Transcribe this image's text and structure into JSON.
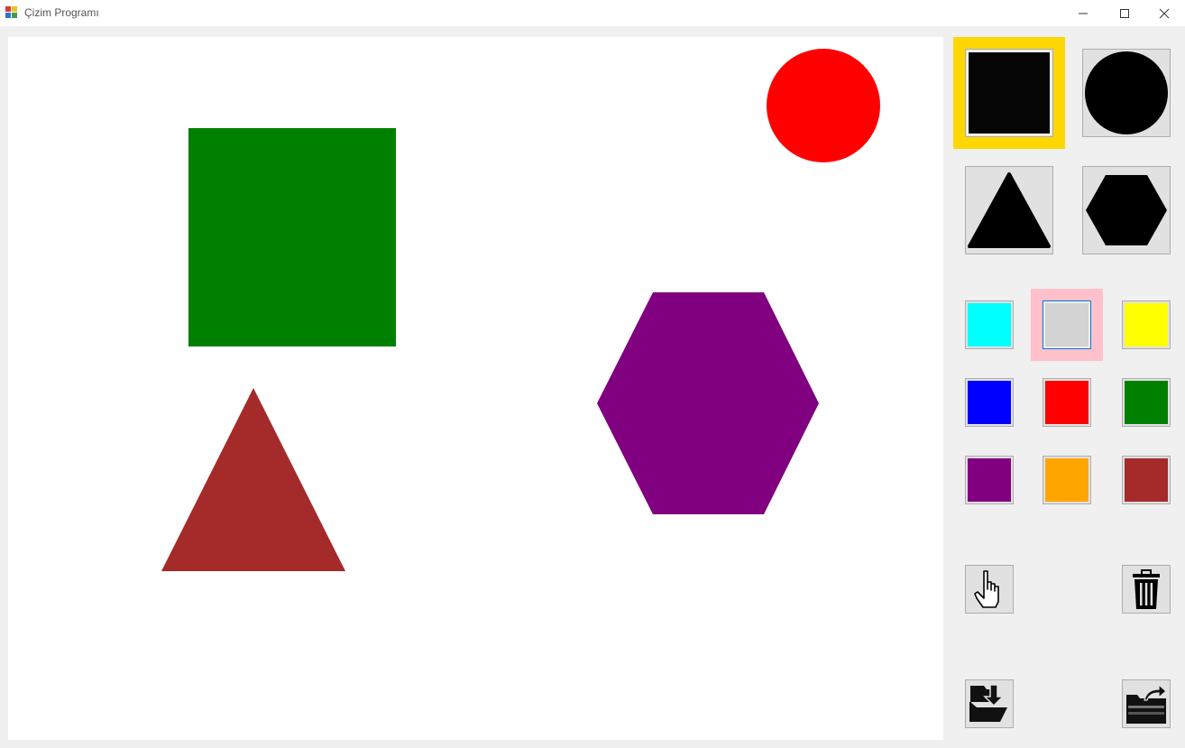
{
  "window": {
    "title": "Çizim Programı"
  },
  "colors": {
    "titlebar_bg": "#ffffff",
    "form_bg": "#f0f0f0",
    "canvas_bg": "#ffffff",
    "selected_shape_highlight": "#ffd700",
    "selected_color_highlight": "#ffc0cb"
  },
  "canvas": {
    "shapes": [
      {
        "type": "circle",
        "color": "#ff0000"
      },
      {
        "type": "square",
        "color": "#008000"
      },
      {
        "type": "triangle",
        "color": "#a52a2a"
      },
      {
        "type": "hexagon",
        "color": "#800080"
      }
    ]
  },
  "shape_tools": [
    {
      "name": "square",
      "icon": "square-icon",
      "selected": true
    },
    {
      "name": "circle",
      "icon": "circle-icon",
      "selected": false
    },
    {
      "name": "triangle",
      "icon": "triangle-icon",
      "selected": false
    },
    {
      "name": "hexagon",
      "icon": "hexagon-icon",
      "selected": false
    }
  ],
  "palette": [
    {
      "name": "cyan",
      "color": "#00ffff",
      "selected": false
    },
    {
      "name": "lightgray",
      "color": "#d3d3d3",
      "selected": true
    },
    {
      "name": "yellow",
      "color": "#ffff00",
      "selected": false
    },
    {
      "name": "blue",
      "color": "#0000ff",
      "selected": false
    },
    {
      "name": "red",
      "color": "#ff0000",
      "selected": false
    },
    {
      "name": "green",
      "color": "#008000",
      "selected": false
    },
    {
      "name": "purple",
      "color": "#800080",
      "selected": false
    },
    {
      "name": "orange",
      "color": "#ffa500",
      "selected": false
    },
    {
      "name": "brown",
      "color": "#a52a2a",
      "selected": false
    }
  ],
  "actions": [
    {
      "name": "select",
      "icon": "hand-pointer-icon"
    },
    {
      "name": "delete",
      "icon": "trash-icon"
    },
    {
      "name": "save",
      "icon": "save-folder-icon"
    },
    {
      "name": "open",
      "icon": "open-folder-icon"
    }
  ]
}
